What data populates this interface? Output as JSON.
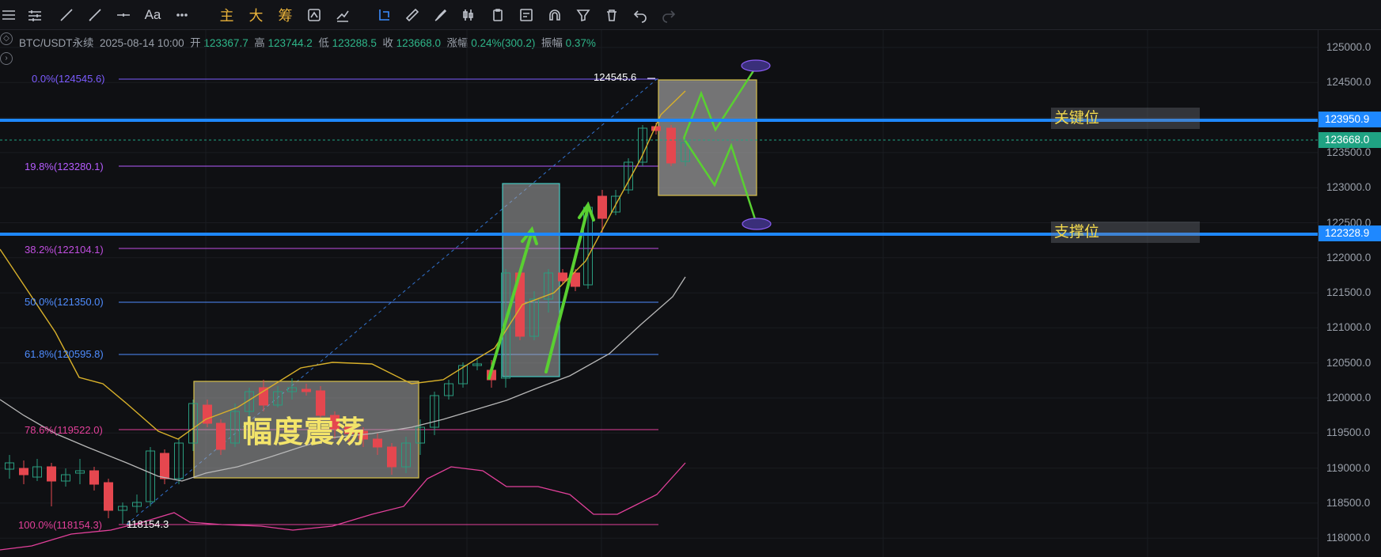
{
  "toolbar": {
    "text_label": "Aa",
    "zhu": "主",
    "da": "大",
    "chou": "筹"
  },
  "info": {
    "symbol": "BTC/USDT永续",
    "datetime": "2025-08-14 10:00",
    "open_label": "开",
    "open": "123367.7",
    "high_label": "高",
    "high": "123744.2",
    "low_label": "低",
    "low": "123288.5",
    "close_label": "收",
    "close": "123668.0",
    "change_label": "涨幅",
    "change": "0.24%(300.2)",
    "amp_label": "振幅",
    "amp": "0.37%"
  },
  "price_axis": [
    "125000.0",
    "124500.0",
    "124000.0",
    "123500.0",
    "123000.0",
    "122500.0",
    "122000.0",
    "121500.0",
    "121000.0",
    "120500.0",
    "120000.0",
    "119500.0",
    "119000.0",
    "118500.0",
    "118000.0"
  ],
  "price_tags": {
    "key_level": "123950.9",
    "last_price": "123668.0",
    "support_level": "122328.9"
  },
  "zones": {
    "key_label": "关键位",
    "support_label": "支撑位"
  },
  "fib": {
    "f0": "0.0%(124545.6)",
    "f198": "19.8%(123280.1)",
    "f382": "38.2%(122104.1)",
    "f500": "50.0%(121350.0)",
    "f618": "61.8%(120595.8)",
    "f786": "78.6%(119522.0)",
    "f100": "100.0%(118154.3)"
  },
  "markers": {
    "high": "124545.6",
    "low": "118154.3"
  },
  "annotation": "幅度震荡",
  "colors": {
    "up": "#2a9d7f",
    "down": "#e5474f",
    "blue_line": "#1e88ff",
    "ma_yellow": "#d8b02a"
  }
}
